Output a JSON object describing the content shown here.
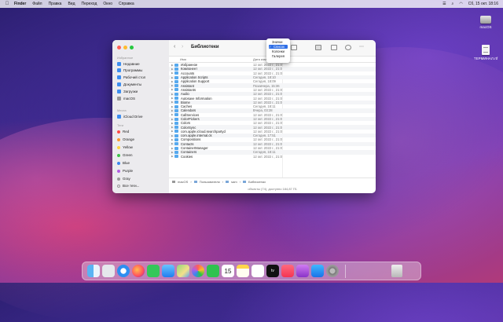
{
  "menubar": {
    "items": [
      "Finder",
      "Файл",
      "Правка",
      "Вид",
      "Переход",
      "Окно",
      "Справка"
    ],
    "clock": "Сб, 15 окт. 18:16"
  },
  "desktop": {
    "items": [
      {
        "label": "macOS",
        "icon": "disk-icon"
      },
      {
        "label": "ТЕРМИНАЛ.rtf",
        "icon": "document-icon"
      }
    ]
  },
  "finder": {
    "title": "Библиотеки",
    "sidebar": {
      "favorites_header": "Избранное",
      "favorites": [
        "Недавние",
        "Программы",
        "Рабочий стол",
        "Документы",
        "Загрузки",
        "macOS"
      ],
      "locations_header": "Места",
      "locations": [
        "iCloud Drive"
      ],
      "tags_header": "Теги",
      "tags": [
        {
          "label": "Red",
          "color": "#ff4b47"
        },
        {
          "label": "Orange",
          "color": "#ff9a2e"
        },
        {
          "label": "Yellow",
          "color": "#ffd23f"
        },
        {
          "label": "Green",
          "color": "#3fc24a"
        },
        {
          "label": "Blue",
          "color": "#3a86f0"
        },
        {
          "label": "Purple",
          "color": "#b25fe3"
        },
        {
          "label": "Gray",
          "color": "#9a9a9a"
        },
        {
          "label": "Все теги...",
          "color": ""
        }
      ]
    },
    "columns": {
      "name": "Имя",
      "date": "Дата изменения"
    },
    "rows": [
      {
        "name": "Избранное",
        "date": "12 окт. 2022 г., 21:07"
      },
      {
        "name": "Компонент",
        "date": "12 окт. 2022 г., 21:07"
      },
      {
        "name": "Accounts",
        "date": "12 окт. 2022 г., 21:07"
      },
      {
        "name": "Application Scripts",
        "date": "Сегодня, 18:10"
      },
      {
        "name": "Application Support",
        "date": "Сегодня, 18:09"
      },
      {
        "name": "Assistant",
        "date": "Позавчера, 15:36"
      },
      {
        "name": "Assistants",
        "date": "12 окт. 2022 г., 21:07"
      },
      {
        "name": "Audio",
        "date": "12 окт. 2022 г., 21:07"
      },
      {
        "name": "Autosave Information",
        "date": "12 окт. 2022 г., 21:07"
      },
      {
        "name": "Biome",
        "date": "12 окт. 2022 г., 21:07"
      },
      {
        "name": "Caches",
        "date": "Сегодня, 18:11"
      },
      {
        "name": "Calendars",
        "date": "Вчера, 03:28"
      },
      {
        "name": "CallServices",
        "date": "12 окт. 2022 г., 21:07"
      },
      {
        "name": "ColorPickers",
        "date": "12 окт. 2022 г., 21:07"
      },
      {
        "name": "Colors",
        "date": "12 окт. 2022 г., 21:07"
      },
      {
        "name": "ColorSync",
        "date": "12 окт. 2022 г., 21:07"
      },
      {
        "name": "com.apple.icloud.searchpartyd",
        "date": "12 окт. 2022 г., 21:07"
      },
      {
        "name": "com.apple.internal.ck",
        "date": "Сегодня, 17:51"
      },
      {
        "name": "Compositions",
        "date": "12 окт. 2022 г., 21:07"
      },
      {
        "name": "Contacts",
        "date": "12 окт. 2022 г., 21:07"
      },
      {
        "name": "ContainerManager",
        "date": "12 окт. 2022 г., 21:07"
      },
      {
        "name": "Containers",
        "date": "Сегодня, 18:11"
      },
      {
        "name": "Cookies",
        "date": "12 окт. 2022 г., 21:07"
      }
    ],
    "path": [
      "macOS",
      "Пользователи",
      "sam",
      "Библиотеки"
    ],
    "status": "объекты (74), доступно 184,87 ГБ"
  },
  "view_menu": {
    "items": [
      "Значки",
      "Список",
      "Колонки",
      "Галерея"
    ],
    "selected_index": 1,
    "checkmark": "✓"
  },
  "dock": {
    "apps": [
      "Finder",
      "Launchpad",
      "Safari",
      "Firefox",
      "Messages",
      "Mail",
      "Maps",
      "Photos",
      "FaceTime",
      "Calendar",
      "Notes",
      "Reminders",
      "TV",
      "Music",
      "Podcasts",
      "App Store",
      "System Preferences",
      "Trash"
    ],
    "calendar_day": "15",
    "tv_label": "tv"
  }
}
